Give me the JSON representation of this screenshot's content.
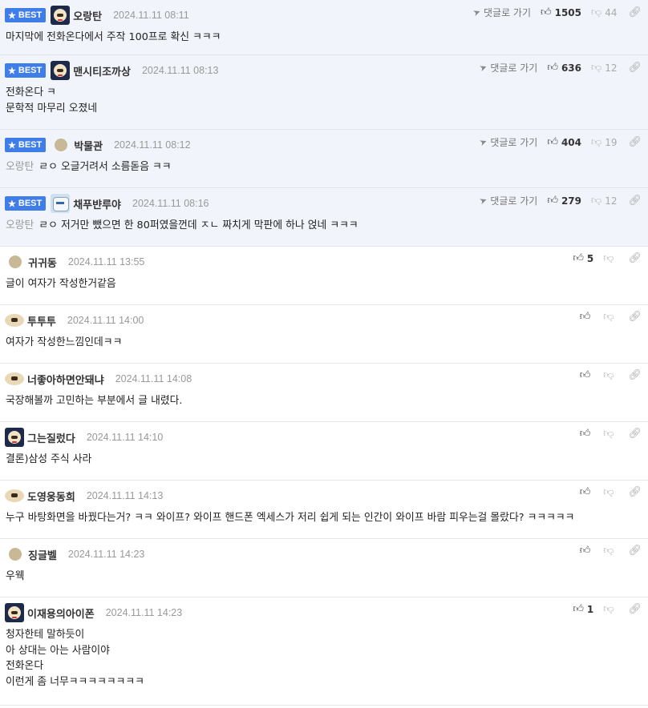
{
  "labels": {
    "best": "BEST",
    "reply": "댓글로 가기"
  },
  "comments": [
    {
      "best": true,
      "avatar": "panda-avatar",
      "nick": "오랑탄",
      "date": "2024.11.11 08:11",
      "up": "1505",
      "down": "44",
      "mention": "",
      "lines": [
        "마지막에 전화온다에서 주작 100프로 확신 ㅋㅋㅋ"
      ]
    },
    {
      "best": true,
      "avatar": "panda-avatar",
      "nick": "맨시티조까상",
      "date": "2024.11.11 08:13",
      "up": "636",
      "down": "12",
      "mention": "",
      "lines": [
        "전화온다 ㅋ",
        "문학적 마무리 오졌네"
      ]
    },
    {
      "best": true,
      "avatar": "dot-avatar",
      "nick": "박물관",
      "date": "2024.11.11 08:12",
      "up": "404",
      "down": "19",
      "mention": "오랑탄",
      "lines": [
        "ㄹㅇ 오글거려서 소름돋음 ㅋㅋ"
      ]
    },
    {
      "best": true,
      "avatar": "robot-avatar",
      "nick": "채푸뱐루야",
      "date": "2024.11.11 08:16",
      "up": "279",
      "down": "12",
      "mention": "오랑탄",
      "lines": [
        "ㄹㅇ 저거만 뺐으면 한 80퍼였을껀데 ㅈㄴ 짜치게 막판에 하나 얹네 ㅋㅋㅋ"
      ]
    },
    {
      "best": false,
      "avatar": "dot-avatar",
      "nick": "귀귀동",
      "date": "2024.11.11 13:55",
      "up": "5",
      "down": "",
      "mention": "",
      "lines": [
        "글이 여자가 작성한거같음"
      ]
    },
    {
      "best": false,
      "avatar": "sheep-avatar",
      "nick": "투투투",
      "date": "2024.11.11 14:00",
      "up": "",
      "down": "",
      "mention": "",
      "lines": [
        "여자가 작성한느낌인데ㅋㅋ"
      ]
    },
    {
      "best": false,
      "avatar": "sheep-avatar",
      "nick": "너좋아하면안돼냐",
      "date": "2024.11.11 14:08",
      "up": "",
      "down": "",
      "mention": "",
      "lines": [
        "국장해볼까 고민하는 부분에서 글 내렸다."
      ]
    },
    {
      "best": false,
      "avatar": "panda-avatar",
      "nick": "그는질렀다",
      "date": "2024.11.11 14:10",
      "up": "",
      "down": "",
      "mention": "",
      "lines": [
        "결론)삼성 주식 사라"
      ]
    },
    {
      "best": false,
      "avatar": "sheep-avatar",
      "nick": "도영웅동희",
      "date": "2024.11.11 14:13",
      "up": "",
      "down": "",
      "mention": "",
      "lines": [
        "누구 바탕화면을 바꿨다는거? ㅋㅋ 와이프? 와이프 핸드폰 엑세스가 저리 쉽게 되는 인간이 와이프 바람 피우는걸 몰랐다? ㅋㅋㅋㅋㅋ"
      ]
    },
    {
      "best": false,
      "avatar": "dot-avatar",
      "nick": "징글벨",
      "date": "2024.11.11 14:23",
      "up": "",
      "down": "",
      "mention": "",
      "lines": [
        "우웩"
      ]
    },
    {
      "best": false,
      "avatar": "panda-avatar",
      "nick": "이재용의아이폰",
      "date": "2024.11.11 14:23",
      "up": "1",
      "down": "",
      "mention": "",
      "lines": [
        "청자한테 말하듯이",
        "아 상대는 아는 사람이야",
        "전화온다",
        "이런게 좀 너무ㅋㅋㅋㅋㅋㅋㅋㅋ"
      ]
    }
  ]
}
